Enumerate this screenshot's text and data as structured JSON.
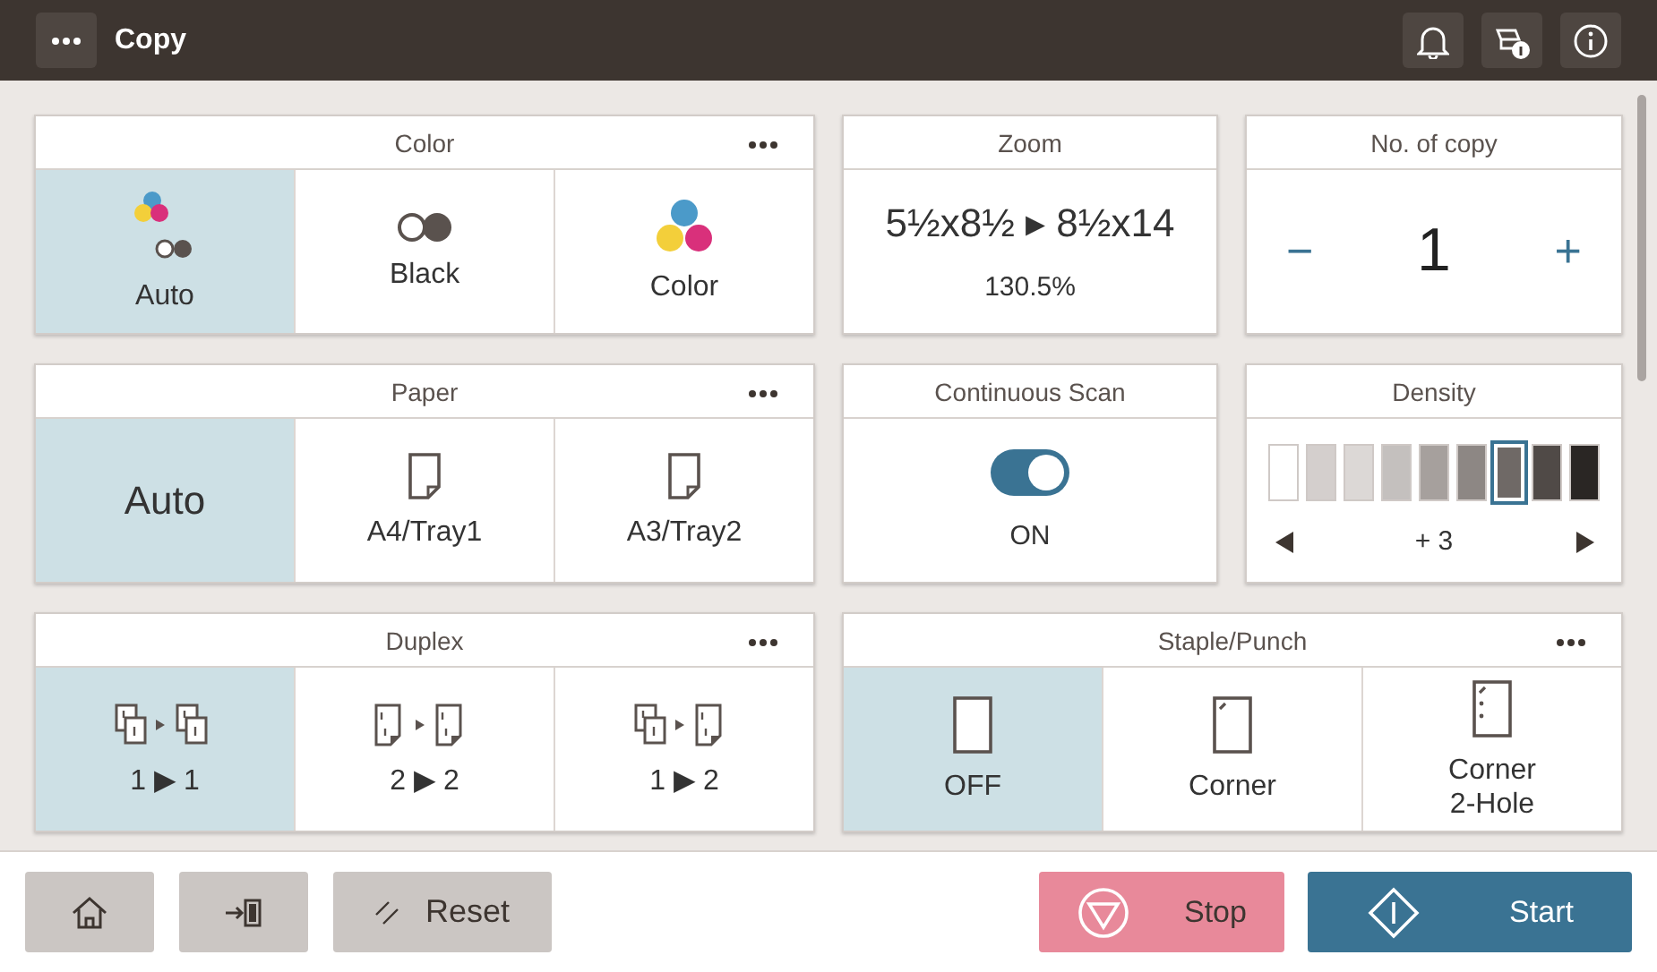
{
  "header": {
    "title": "Copy"
  },
  "panels": [
    {
      "kind": "options",
      "title": "Color",
      "options": [
        {
          "label": "Auto",
          "kind": "auto-color",
          "selected": true
        },
        {
          "label": "Black",
          "kind": "black",
          "selected": false
        },
        {
          "label": "Color",
          "kind": "color",
          "selected": false
        }
      ]
    },
    {
      "kind": "zoom",
      "title": "Zoom",
      "sizes": "5½x8½ ▸ 8½x14",
      "percent": "130.5%"
    },
    {
      "kind": "counter",
      "title": "No. of copy",
      "minus": "−",
      "value": "1",
      "plus": "+"
    },
    {
      "kind": "options",
      "title": "Paper",
      "options": [
        {
          "label": "Auto",
          "kind": "text",
          "selected": true
        },
        {
          "label": "A4/Tray1",
          "kind": "paper",
          "selected": false
        },
        {
          "label": "A3/Tray2",
          "kind": "paper",
          "selected": false
        }
      ]
    },
    {
      "kind": "toggle",
      "title": "Continuous Scan",
      "on": true,
      "label": "ON"
    },
    {
      "kind": "density",
      "title": "Density",
      "value": "+ 3",
      "swatches": [
        {
          "color": "#ffffff",
          "selected": false
        },
        {
          "color": "#d4cfcd",
          "selected": false
        },
        {
          "color": "#dcd8d6",
          "selected": false
        },
        {
          "color": "#c4c0be",
          "selected": false
        },
        {
          "color": "#a6a09d",
          "selected": false
        },
        {
          "color": "#8d8784",
          "selected": false
        },
        {
          "color": "#6f6966",
          "selected": true
        },
        {
          "color": "#504a47",
          "selected": false
        },
        {
          "color": "#2a2624",
          "selected": false
        }
      ]
    },
    {
      "kind": "options",
      "title": "Duplex",
      "options": [
        {
          "label": "1 ▶ 1",
          "kind": "simplex-simplex",
          "selected": true
        },
        {
          "label": "2 ▶ 2",
          "kind": "duplex-duplex",
          "selected": false
        },
        {
          "label": "1 ▶ 2",
          "kind": "simplex-duplex",
          "selected": false
        }
      ]
    },
    {
      "kind": "options",
      "title": "Staple/Punch",
      "options": [
        {
          "label": "OFF",
          "kind": "sheet",
          "selected": true
        },
        {
          "label": "Corner",
          "kind": "sheet-corner",
          "selected": false
        },
        {
          "label": "Corner\n2-Hole",
          "kind": "sheet-corner-holes",
          "selected": false
        }
      ]
    }
  ],
  "footer": {
    "reset": "Reset",
    "stop": "Stop",
    "start": "Start"
  }
}
